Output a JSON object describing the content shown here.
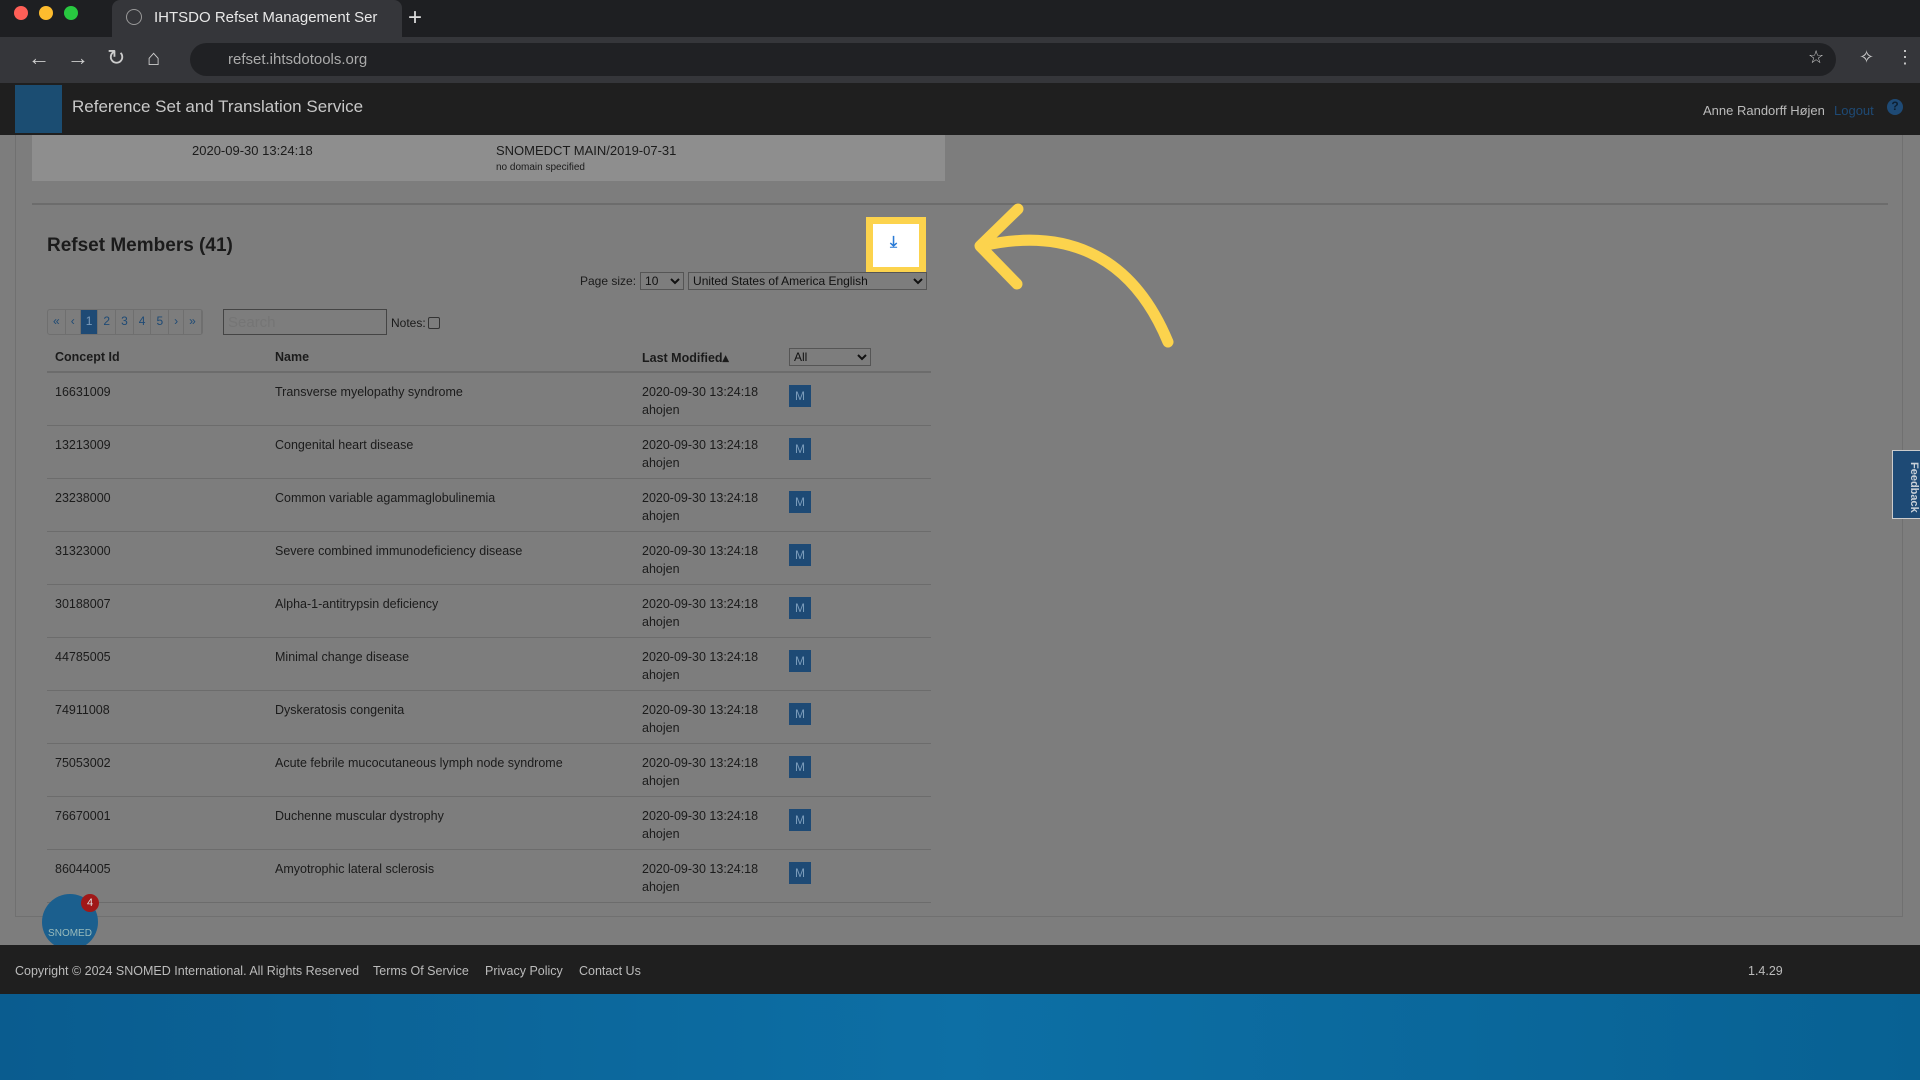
{
  "browser": {
    "tab_title": "IHTSDO Refset Management Ser",
    "url": "refset.ihtsdotools.org"
  },
  "app": {
    "logo_text": "SNOMED",
    "title": "Reference Set and Translation Service",
    "user": "Anne Randorff Højen",
    "logout": "Logout",
    "help": "?"
  },
  "panel": {
    "date": "2020-09-30 13:24:18",
    "edition": "SNOMEDCT MAIN/2019-07-31",
    "domain": "no domain specified"
  },
  "members": {
    "title": "Refset Members (41)",
    "page_size_label": "Page size:",
    "page_size": "10",
    "language": "United States of America English",
    "pager": [
      "«",
      "‹",
      "1",
      "2",
      "3",
      "4",
      "5",
      "›",
      "»"
    ],
    "active_page": "1",
    "search_placeholder": "Search",
    "notes_label": "Notes:",
    "filter": "All",
    "columns": [
      "Concept Id",
      "Name",
      "Last Modified▴"
    ],
    "rows": [
      {
        "id": "16631009",
        "name": "Transverse myelopathy syndrome",
        "date": "2020-09-30 13:24:18",
        "user": "ahojen",
        "action": "M"
      },
      {
        "id": "13213009",
        "name": "Congenital heart disease",
        "date": "2020-09-30 13:24:18",
        "user": "ahojen",
        "action": "M"
      },
      {
        "id": "23238000",
        "name": "Common variable agammaglobulinemia",
        "date": "2020-09-30 13:24:18",
        "user": "ahojen",
        "action": "M"
      },
      {
        "id": "31323000",
        "name": "Severe combined immunodeficiency disease",
        "date": "2020-09-30 13:24:18",
        "user": "ahojen",
        "action": "M"
      },
      {
        "id": "30188007",
        "name": "Alpha-1-antitrypsin deficiency",
        "date": "2020-09-30 13:24:18",
        "user": "ahojen",
        "action": "M"
      },
      {
        "id": "44785005",
        "name": "Minimal change disease",
        "date": "2020-09-30 13:24:18",
        "user": "ahojen",
        "action": "M"
      },
      {
        "id": "74911008",
        "name": "Dyskeratosis congenita",
        "date": "2020-09-30 13:24:18",
        "user": "ahojen",
        "action": "M"
      },
      {
        "id": "75053002",
        "name": "Acute febrile mucocutaneous lymph node syndrome",
        "date": "2020-09-30 13:24:18",
        "user": "ahojen",
        "action": "M"
      },
      {
        "id": "76670001",
        "name": "Duchenne muscular dystrophy",
        "date": "2020-09-30 13:24:18",
        "user": "ahojen",
        "action": "M"
      },
      {
        "id": "86044005",
        "name": "Amyotrophic lateral sclerosis",
        "date": "2020-09-30 13:24:18",
        "user": "ahojen",
        "action": "M"
      }
    ]
  },
  "footer": {
    "copyright": "Copyright © 2024 SNOMED International. All Rights Reserved",
    "terms": "Terms Of Service",
    "privacy": "Privacy Policy",
    "contact": "Contact Us",
    "version": "1.4.29"
  },
  "feedback": "Feedback",
  "chat": {
    "label": "SNOMED",
    "badge": "4"
  },
  "colors": {
    "highlight": "#fcd34d",
    "primary": "#1e4a75",
    "download_icon": "#2b7bd6"
  }
}
